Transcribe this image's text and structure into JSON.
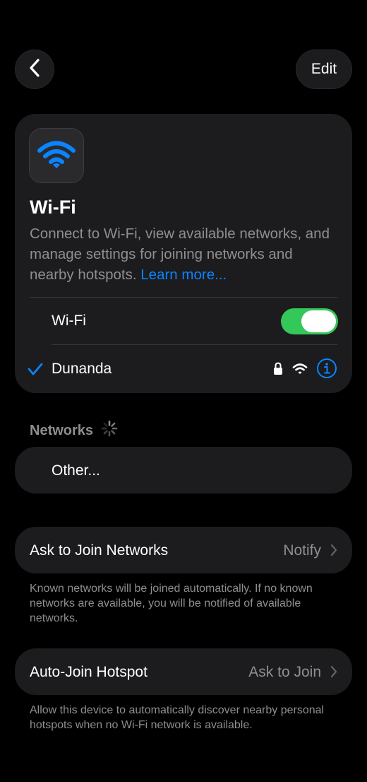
{
  "nav": {
    "back_icon": "chevron-left-icon",
    "edit_label": "Edit"
  },
  "hero": {
    "icon": "wifi-icon",
    "title": "Wi-Fi",
    "description": "Connect to Wi-Fi, view available networks, and manage settings for joining networks and nearby hotspots.",
    "learn_more": "Learn more..."
  },
  "wifi_toggle": {
    "label": "Wi-Fi",
    "state": "on"
  },
  "connected_network": {
    "name": "Dunanda",
    "icons": [
      "checkmark-icon",
      "lock-icon",
      "wifi-signal-icon",
      "info-icon"
    ]
  },
  "networks": {
    "header": "Networks",
    "other_label": "Other..."
  },
  "ask_to_join": {
    "label": "Ask to Join Networks",
    "value": "Notify",
    "footnote": "Known networks will be joined automatically. If no known networks are available, you will be notified of available networks."
  },
  "auto_join_hotspot": {
    "label": "Auto-Join Hotspot",
    "value": "Ask to Join",
    "footnote": "Allow this device to automatically discover nearby personal hotspots when no Wi-Fi network is available."
  },
  "colors": {
    "accent": "#0a84ff",
    "toggle_on": "#34c759",
    "card_bg": "#1c1c1e",
    "secondary_text": "#8e8e93"
  }
}
